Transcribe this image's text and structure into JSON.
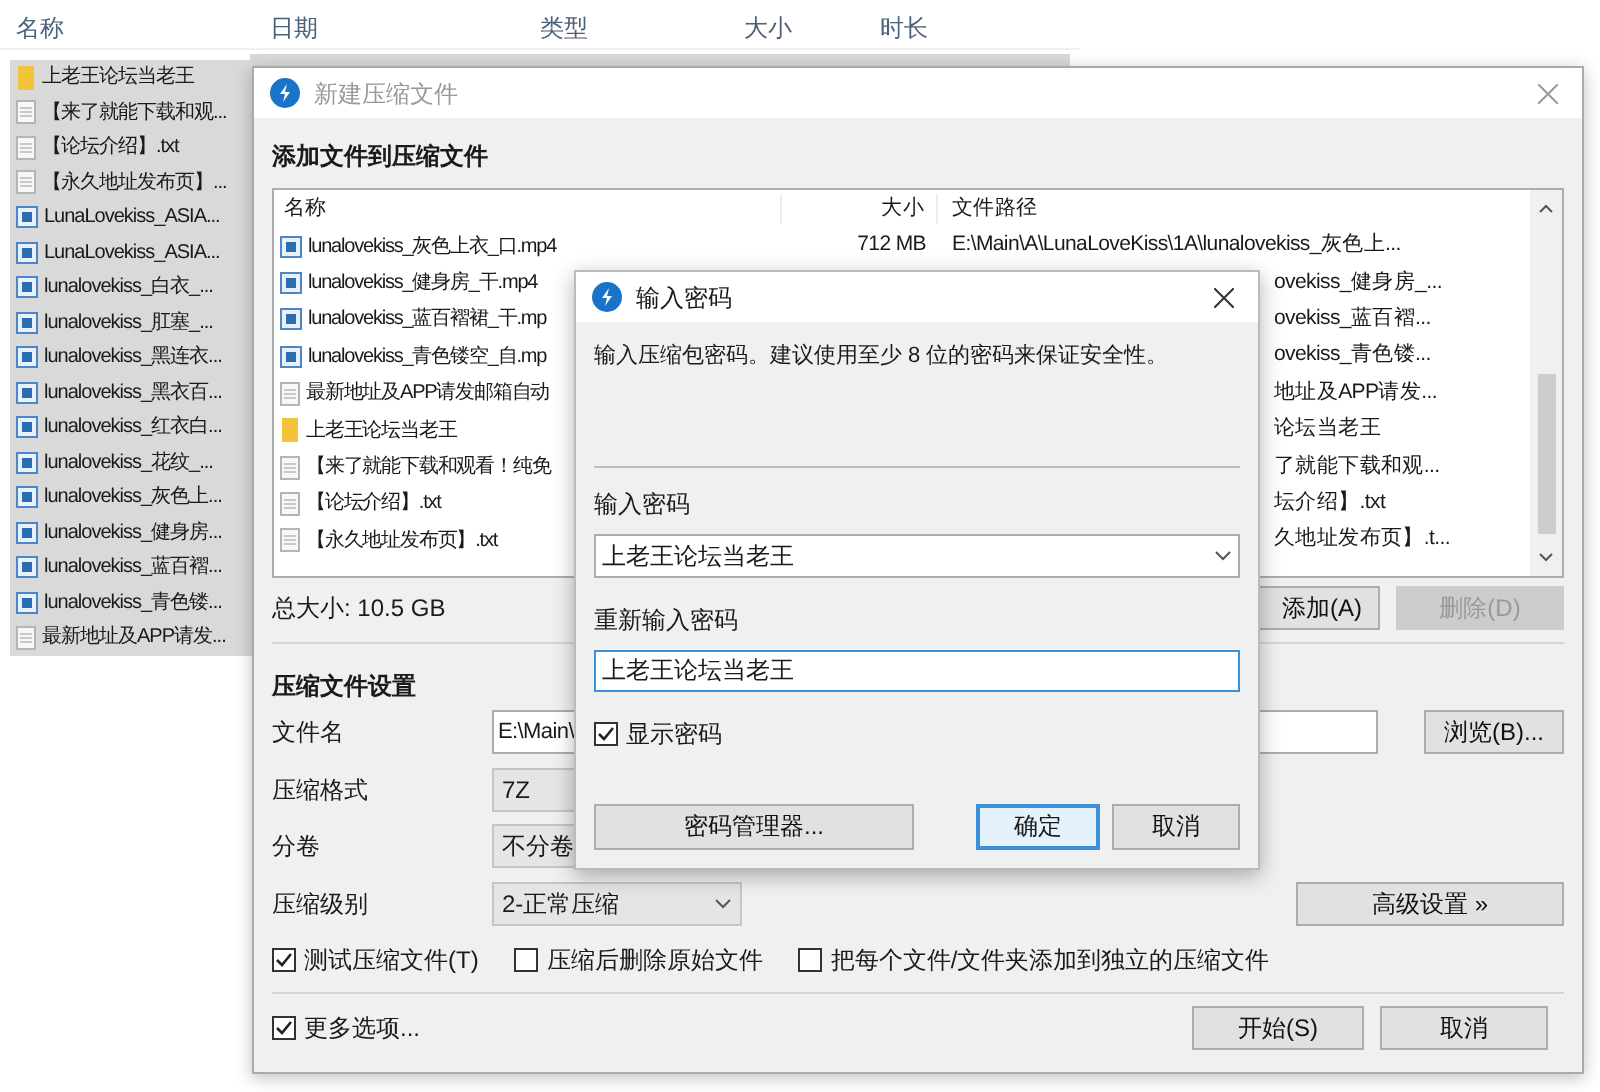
{
  "explorer": {
    "columns": [
      "名称",
      "日期",
      "类型",
      "大小",
      "时长"
    ],
    "rows": [
      {
        "kind": "folder",
        "name": "上老王论坛当老王",
        "selected": true
      },
      {
        "kind": "text",
        "name": "【来了就能下载和观...",
        "selected": true
      },
      {
        "kind": "text",
        "name": "【论坛介绍】.txt",
        "selected": true
      },
      {
        "kind": "text",
        "name": "【永久地址发布页】...",
        "selected": true
      },
      {
        "kind": "video",
        "name": "LunaLovekiss_ASIA...",
        "selected": true
      },
      {
        "kind": "video",
        "name": "LunaLovekiss_ASIA...",
        "selected": true
      },
      {
        "kind": "video",
        "name": "lunalovekiss_白衣_...",
        "selected": true
      },
      {
        "kind": "video",
        "name": "lunalovekiss_肛塞_...",
        "selected": true
      },
      {
        "kind": "video",
        "name": "lunalovekiss_黑连衣...",
        "selected": true
      },
      {
        "kind": "video",
        "name": "lunalovekiss_黑衣百...",
        "selected": true
      },
      {
        "kind": "video",
        "name": "lunalovekiss_红衣白...",
        "selected": true
      },
      {
        "kind": "video",
        "name": "lunalovekiss_花纹_...",
        "selected": true
      },
      {
        "kind": "video",
        "name": "lunalovekiss_灰色上...",
        "selected": true
      },
      {
        "kind": "video",
        "name": "lunalovekiss_健身房...",
        "selected": true
      },
      {
        "kind": "video",
        "name": "lunalovekiss_蓝百褶...",
        "selected": true
      },
      {
        "kind": "video",
        "name": "lunalovekiss_青色镂...",
        "selected": true
      },
      {
        "kind": "text",
        "name": "最新地址及APP请发...",
        "selected": true
      }
    ]
  },
  "archive_dialog": {
    "title": "新建压缩文件",
    "section_title": "添加文件到压缩文件",
    "file_list": {
      "columns": [
        "名称",
        "大小",
        "文件路径"
      ],
      "rows": [
        {
          "kind": "video",
          "name": "lunalovekiss_灰色上衣_口.mp4",
          "size": "712 MB",
          "path": "E:\\Main\\A\\LunaLoveKiss\\1A\\lunalovekiss_灰色上..."
        },
        {
          "kind": "video",
          "name": "lunalovekiss_健身房_干.mp4",
          "path": "ovekiss_健身房_..."
        },
        {
          "kind": "video",
          "name": "lunalovekiss_蓝百褶裙_干.mp",
          "path": "ovekiss_蓝百褶..."
        },
        {
          "kind": "video",
          "name": "lunalovekiss_青色镂空_自.mp",
          "path": "ovekiss_青色镂..."
        },
        {
          "kind": "text",
          "name": "最新地址及APP请发邮箱自动",
          "path": "地址及APP请发..."
        },
        {
          "kind": "folder",
          "name": "上老王论坛当老王",
          "path": "论坛当老王"
        },
        {
          "kind": "text",
          "name": "【来了就能下载和观看！纯免",
          "path": "了就能下载和观..."
        },
        {
          "kind": "text",
          "name": "【论坛介绍】.txt",
          "path": "坛介绍】.txt"
        },
        {
          "kind": "text",
          "name": "【永久地址发布页】.txt",
          "path": "久地址发布页】.t..."
        }
      ]
    },
    "total_size": "总大小: 10.5 GB",
    "add_button": "添加(A)",
    "delete_button": {
      "label": "删除(D)",
      "disabled": true
    },
    "settings_title": "压缩文件设置",
    "fields": [
      {
        "kind": "text",
        "label": "文件名",
        "value": "E:\\Main\\"
      },
      {
        "kind": "select",
        "label": "压缩格式",
        "value": "7Z"
      },
      {
        "kind": "select",
        "label": "分卷",
        "value": "不分卷"
      },
      {
        "kind": "dropdown",
        "label": "压缩级别",
        "value": "2-正常压缩"
      }
    ],
    "browse_button": "浏览(B)...",
    "advanced_button": "高级设置 »",
    "options": [
      {
        "label": "测试压缩文件(T)",
        "checked": true
      },
      {
        "label": "压缩后删除原始文件",
        "checked": false
      },
      {
        "label": "把每个文件/文件夹添加到独立的压缩文件",
        "checked": false
      }
    ],
    "more_options": {
      "label": "更多选项...",
      "checked": true
    },
    "start_button": "开始(S)",
    "cancel_button": "取消"
  },
  "password_dialog": {
    "title": "输入密码",
    "hint": "输入压缩包密码。建议使用至少 8 位的密码来保证安全性。",
    "password_label": "输入密码",
    "password_value": "上老王论坛当老王",
    "confirm_label": "重新输入密码",
    "confirm_value": "上老王论坛当老王",
    "show_password": {
      "label": "显示密码",
      "checked": true
    },
    "manager_button": "密码管理器...",
    "ok_button": "确定",
    "cancel_button": "取消"
  }
}
